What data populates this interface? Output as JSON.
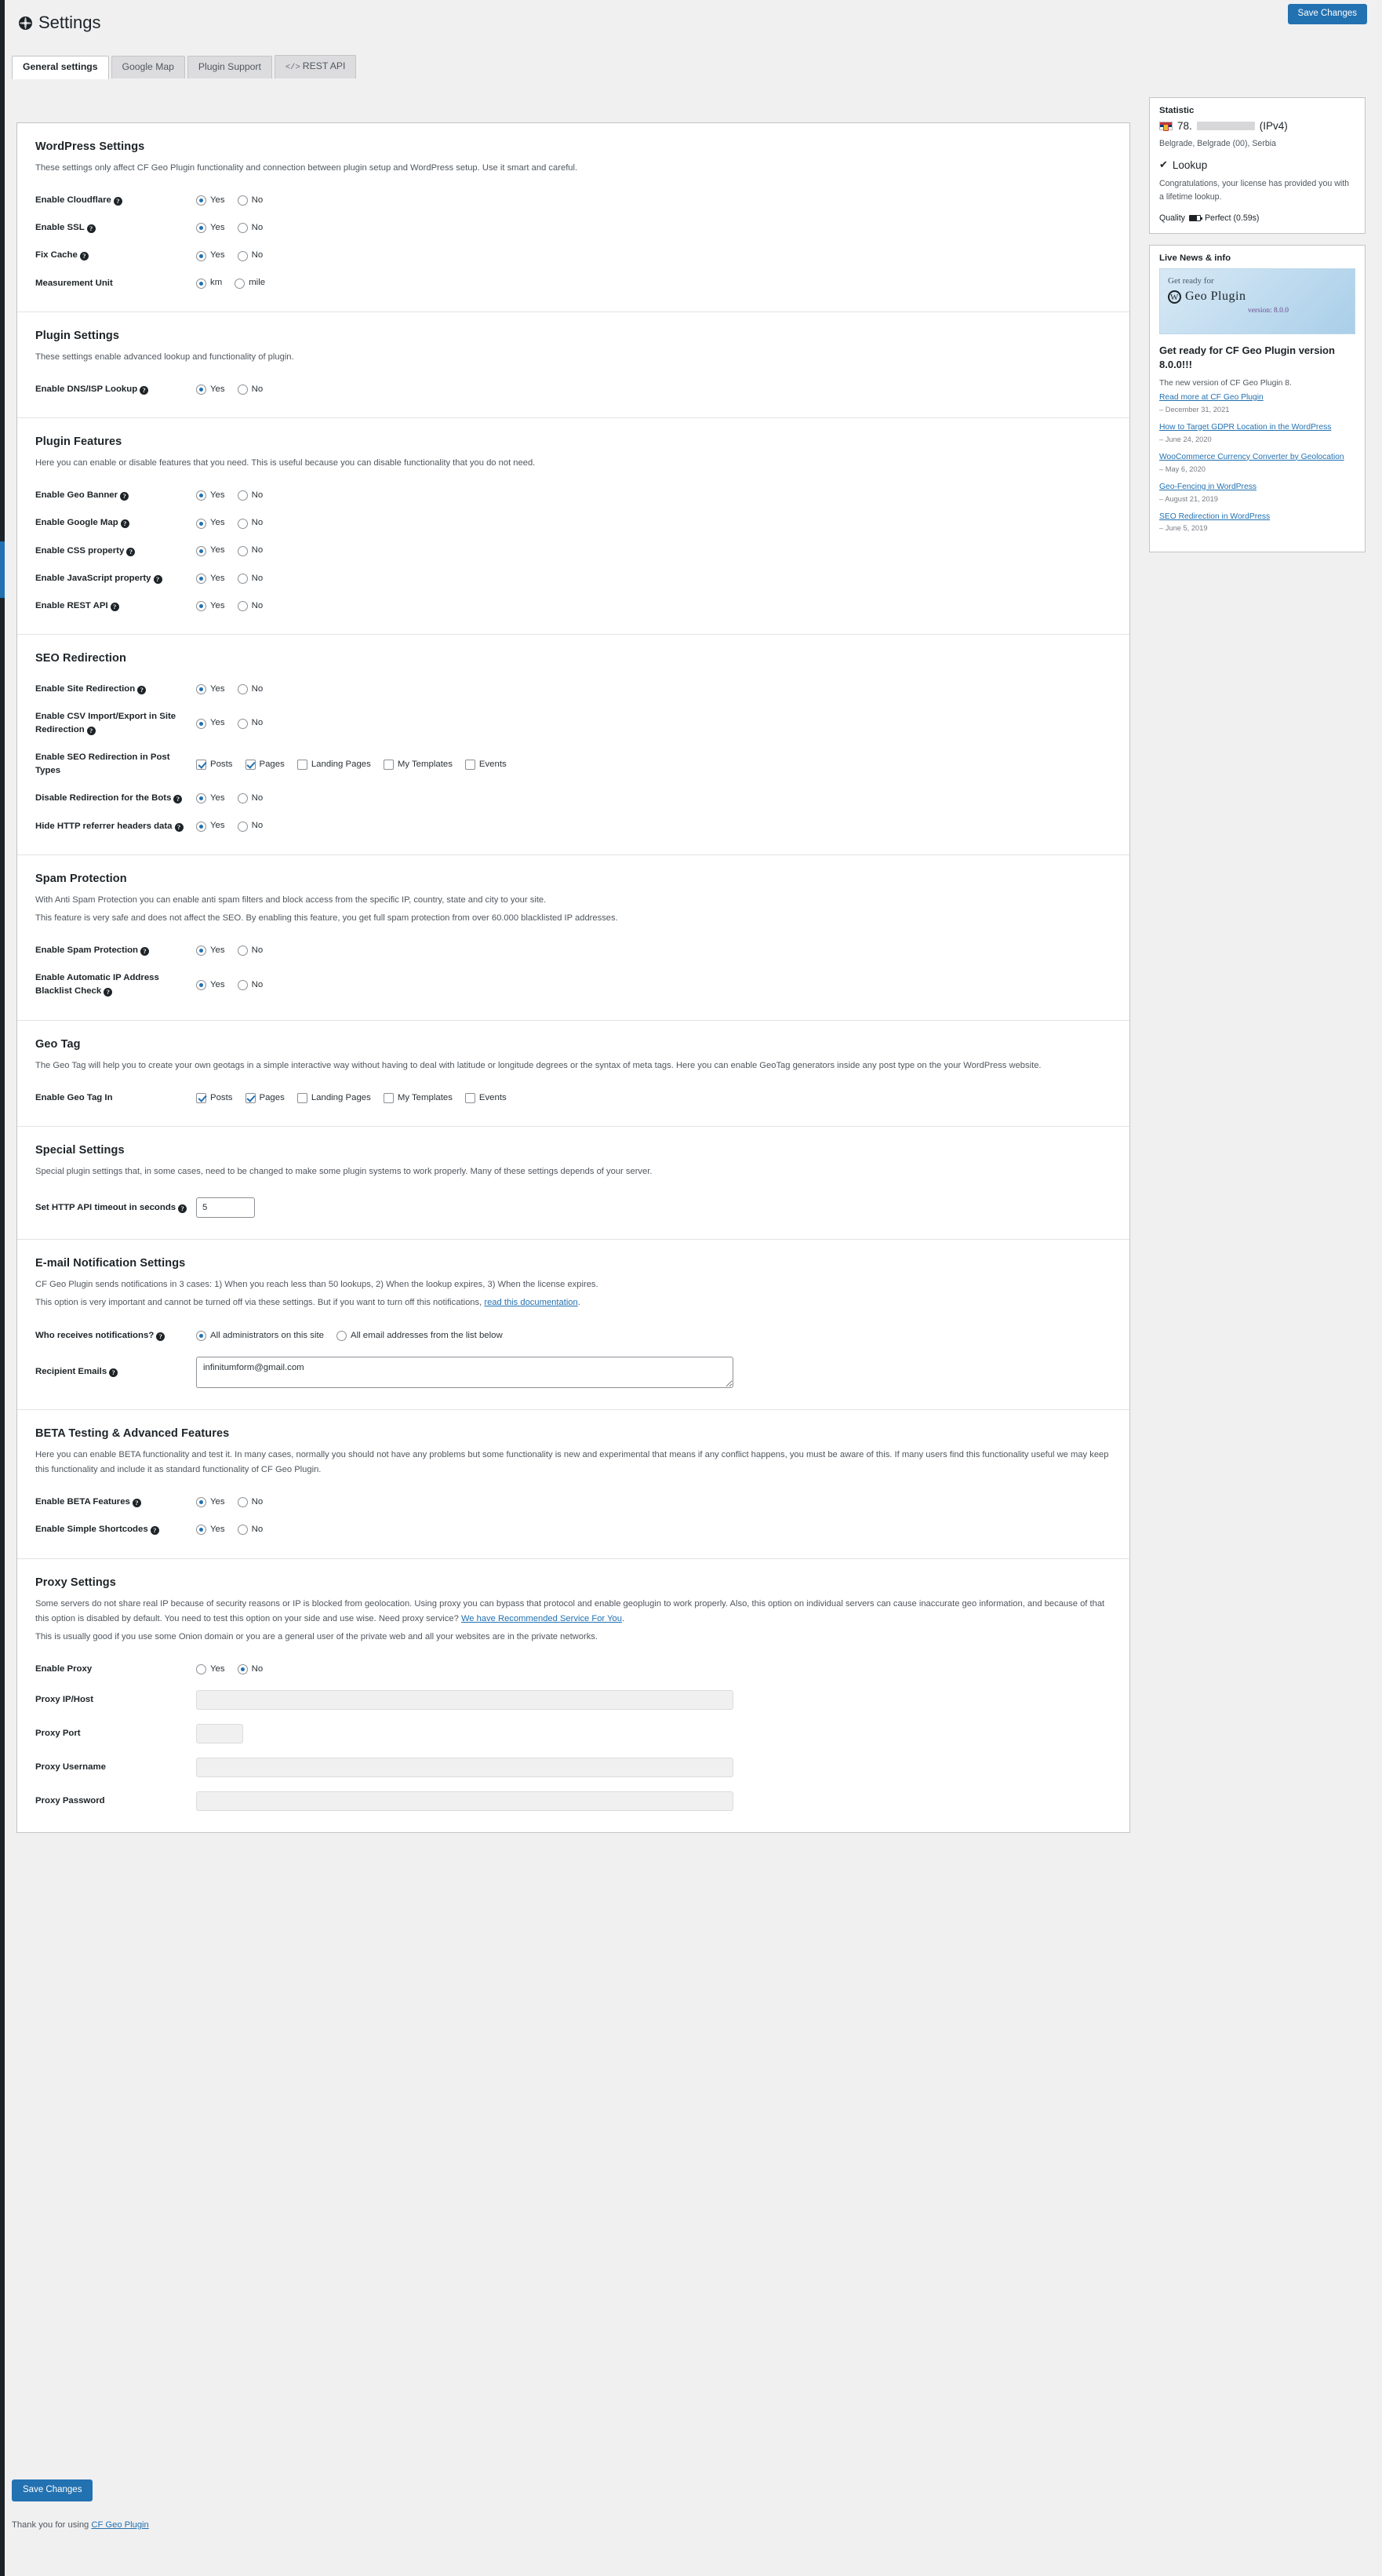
{
  "header": {
    "title": "Settings",
    "save_label": "Save Changes"
  },
  "tabs": [
    {
      "label": "General settings",
      "active": true
    },
    {
      "label": "Google Map",
      "active": false
    },
    {
      "label": "Plugin Support",
      "active": false
    },
    {
      "label": "REST API",
      "active": false,
      "prefix": "</>"
    }
  ],
  "options": {
    "yes": "Yes",
    "no": "No",
    "km": "km",
    "mile": "mile"
  },
  "sections": {
    "wordpress": {
      "title": "WordPress Settings",
      "desc": "These settings only affect CF Geo Plugin functionality and connection between plugin setup and WordPress setup. Use it smart and careful.",
      "rows": [
        {
          "label": "Enable Cloudflare",
          "help": true,
          "value": "yes"
        },
        {
          "label": "Enable SSL",
          "help": true,
          "value": "yes"
        },
        {
          "label": "Fix Cache",
          "help": true,
          "value": "yes"
        },
        {
          "label": "Measurement Unit",
          "help": false,
          "value": "km"
        }
      ]
    },
    "plugin_settings": {
      "title": "Plugin Settings",
      "desc": "These settings enable advanced lookup and functionality of plugin.",
      "rows": [
        {
          "label": "Enable DNS/ISP Lookup",
          "help": true,
          "value": "yes"
        }
      ]
    },
    "plugin_features": {
      "title": "Plugin Features",
      "desc": "Here you can enable or disable features that you need. This is useful because you can disable functionality that you do not need.",
      "rows": [
        {
          "label": "Enable Geo Banner",
          "help": true,
          "value": "yes"
        },
        {
          "label": "Enable Google Map",
          "help": true,
          "value": "yes"
        },
        {
          "label": "Enable CSS property",
          "help": true,
          "value": "yes"
        },
        {
          "label": "Enable JavaScript property",
          "help": true,
          "value": "yes"
        },
        {
          "label": "Enable REST API",
          "help": true,
          "value": "yes"
        }
      ]
    },
    "seo": {
      "title": "SEO Redirection",
      "rows": [
        {
          "label": "Enable Site Redirection",
          "help": true,
          "value": "yes"
        },
        {
          "label": "Enable CSV Import/Export in Site Redirection",
          "help": true,
          "value": "yes"
        },
        {
          "label": "Enable SEO Redirection in Post Types",
          "help": false,
          "type": "checkboxes"
        },
        {
          "label": "Disable Redirection for the Bots",
          "help": true,
          "value": "yes"
        },
        {
          "label": "Hide HTTP referrer headers data",
          "help": true,
          "value": "yes"
        }
      ],
      "post_types": [
        {
          "label": "Posts",
          "checked": true
        },
        {
          "label": "Pages",
          "checked": true
        },
        {
          "label": "Landing Pages",
          "checked": false
        },
        {
          "label": "My Templates",
          "checked": false
        },
        {
          "label": "Events",
          "checked": false
        }
      ]
    },
    "spam": {
      "title": "Spam Protection",
      "desc1": "With Anti Spam Protection you can enable anti spam filters and block access from the specific IP, country, state and city to your site.",
      "desc2": "This feature is very safe and does not affect the SEO. By enabling this feature, you get full spam protection from over 60.000 blacklisted IP addresses.",
      "rows": [
        {
          "label": "Enable Spam Protection",
          "help": true,
          "value": "yes"
        },
        {
          "label": "Enable Automatic IP Address Blacklist Check",
          "help": true,
          "value": "yes"
        }
      ]
    },
    "geotag": {
      "title": "Geo Tag",
      "desc": "The Geo Tag will help you to create your own geotags in a simple interactive way without having to deal with latitude or longitude degrees or the syntax of meta tags. Here you can enable GeoTag generators inside any post type on the your WordPress website.",
      "row_label": "Enable Geo Tag In",
      "post_types": [
        {
          "label": "Posts",
          "checked": true
        },
        {
          "label": "Pages",
          "checked": true
        },
        {
          "label": "Landing Pages",
          "checked": false
        },
        {
          "label": "My Templates",
          "checked": false
        },
        {
          "label": "Events",
          "checked": false
        }
      ]
    },
    "special": {
      "title": "Special Settings",
      "desc": "Special plugin settings that, in some cases, need to be changed to make some plugin systems to work properly. Many of these settings depends of your server.",
      "timeout_label": "Set HTTP API timeout in seconds",
      "timeout_value": "5"
    },
    "email": {
      "title": "E-mail Notification Settings",
      "desc1": "CF Geo Plugin sends notifications in 3 cases: 1) When you reach less than 50 lookups, 2) When the lookup expires, 3) When the license expires.",
      "desc2_pre": "This option is very important and cannot be turned off via these settings. But if you want to turn off this notifications, ",
      "desc2_link": "read this documentation",
      "desc2_post": ".",
      "who_label": "Who receives notifications?",
      "who_opt1": "All administrators on this site",
      "who_opt2": "All email addresses from the list below",
      "who_value": "opt1",
      "recipients_label": "Recipient Emails",
      "recipients_value": "infinitumform@gmail.com"
    },
    "beta": {
      "title": "BETA Testing & Advanced Features",
      "desc": "Here you can enable BETA functionality and test it. In many cases, normally you should not have any problems but some functionality is new and experimental that means if any conflict happens, you must be aware of this. If many users find this functionality useful we may keep this functionality and include it as standard functionality of CF Geo Plugin.",
      "rows": [
        {
          "label": "Enable BETA Features",
          "help": true,
          "value": "yes"
        },
        {
          "label": "Enable Simple Shortcodes",
          "help": true,
          "value": "yes"
        }
      ]
    },
    "proxy": {
      "title": "Proxy Settings",
      "desc1_pre": "Some servers do not share real IP because of security reasons or IP is blocked from geolocation. Using proxy you can bypass that protocol and enable geoplugin to work properly. Also, this option on individual servers can cause inaccurate geo information, and because of that this option is disabled by default. You need to test this option on your side and use wise. Need proxy service? ",
      "desc1_link": "We have Recommended Service For You",
      "desc1_post": ".",
      "desc2": "This is usually good if you use some Onion domain or you are a general user of the private web and all your websites are in the private networks.",
      "enable_label": "Enable Proxy",
      "enable_value": "no",
      "fields": [
        {
          "label": "Proxy IP/Host",
          "value": "",
          "kind": "wide"
        },
        {
          "label": "Proxy Port",
          "value": "",
          "kind": "port"
        },
        {
          "label": "Proxy Username",
          "value": "",
          "kind": "wide"
        },
        {
          "label": "Proxy Password",
          "value": "",
          "kind": "wide"
        }
      ]
    }
  },
  "footer": {
    "save_label": "Save Changes",
    "thanks_pre": "Thank you for using ",
    "thanks_link": "CF Geo Plugin"
  },
  "sidebar": {
    "statistic": {
      "title": "Statistic",
      "ip_prefix": "78.",
      "ip_suffix": "(IPv4)",
      "location": "Belgrade, Belgrade (00), Serbia",
      "lookup_title": "Lookup",
      "lookup_text": "Congratulations, your license has provided you with a lifetime lookup.",
      "quality_label": "Quality",
      "quality_value": "Perfect (0.59s)"
    },
    "news": {
      "box_title": "Live News & info",
      "promo_line1": "Get ready for",
      "promo_line2": "Geo Plugin",
      "promo_line3": "version: 8.0.0",
      "headline": "Get ready for CF Geo Plugin version 8.0.0!!!",
      "sub": "The new version of CF Geo Plugin 8.",
      "main_link": "Read more at CF Geo Plugin",
      "main_date": "– December 31, 2021",
      "items": [
        {
          "link": "How to Target GDPR Location in the WordPress",
          "date": "– June 24, 2020"
        },
        {
          "link": "WooCommerce Currency Converter by Geolocation",
          "date": "– May 6, 2020"
        },
        {
          "link": "Geo-Fencing in WordPress",
          "date": "– August 21, 2019"
        },
        {
          "link": "SEO Redirection in WordPress",
          "date": "– June 5, 2019"
        }
      ]
    }
  }
}
